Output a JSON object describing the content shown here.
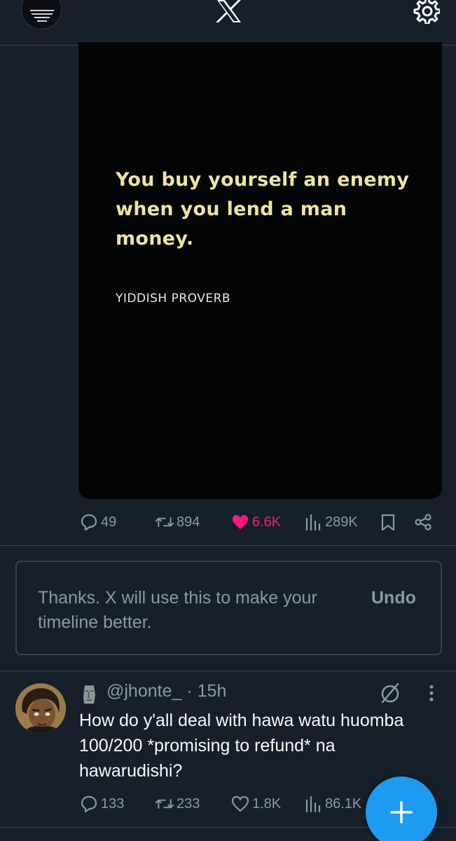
{
  "header": {
    "logo_icon": "x-logo-icon",
    "settings_icon": "gear-icon"
  },
  "tweet1": {
    "media": {
      "quote": "You buy yourself an enemy when you lend a man money.",
      "source": "YIDDISH PROVERB"
    },
    "stats": {
      "replies": "49",
      "retweets": "894",
      "likes": "6.6K",
      "views": "289K"
    }
  },
  "feedback": {
    "message": "Thanks. X will use this to make your timeline better.",
    "undo_label": "Undo"
  },
  "tweet2": {
    "handle": "@jhonte_",
    "time": "· 15h",
    "text": "How do y'all deal with hawa watu huomba 100/200 *promising to refund* na hawarudishi?",
    "stats": {
      "replies": "133",
      "retweets": "233",
      "likes": "1.8K",
      "views": "86.1K"
    }
  },
  "colors": {
    "background": "#15202b",
    "divider": "#38444d",
    "muted_text": "#8b98a5",
    "like_pink": "#f91880",
    "accent_blue": "#1d9bf0"
  }
}
